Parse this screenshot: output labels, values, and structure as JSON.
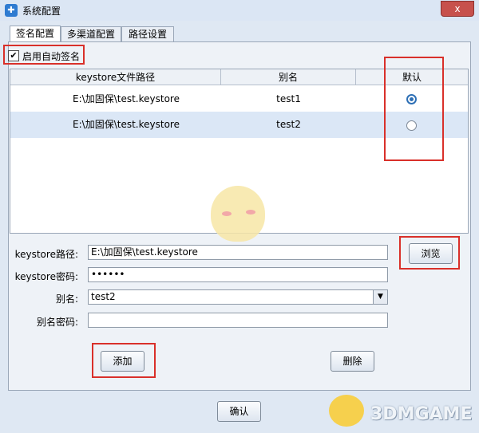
{
  "window": {
    "title": "系统配置",
    "close_label": "x"
  },
  "tabs": [
    {
      "label": "签名配置",
      "active": true
    },
    {
      "label": "多渠道配置",
      "active": false
    },
    {
      "label": "路径设置",
      "active": false
    }
  ],
  "auto_sign": {
    "label": "启用自动签名",
    "checked": true,
    "check_glyph": "✔"
  },
  "table": {
    "columns": [
      "keystore文件路径",
      "别名",
      "默认"
    ],
    "rows": [
      {
        "path": "E:\\加固保\\test.keystore",
        "alias": "test1",
        "default": true,
        "selected": false
      },
      {
        "path": "E:\\加固保\\test.keystore",
        "alias": "test2",
        "default": false,
        "selected": true
      }
    ]
  },
  "form": {
    "keystore_path_label": "keystore路径:",
    "keystore_path_value": "E:\\加固保\\test.keystore",
    "browse_label": "浏览",
    "keystore_password_label": "keystore密码:",
    "keystore_password_value": "••••••",
    "alias_label": "别名:",
    "alias_value": "test2",
    "alias_password_label": "别名密码:",
    "alias_password_value": ""
  },
  "buttons": {
    "add": "添加",
    "delete": "删除",
    "confirm": "确认"
  },
  "watermark": {
    "text": "3DMGAME"
  },
  "colors": {
    "highlight_box": "#d9302a",
    "selected_row": "#dbe7f6",
    "radio_checked": "#2d6fb5"
  }
}
